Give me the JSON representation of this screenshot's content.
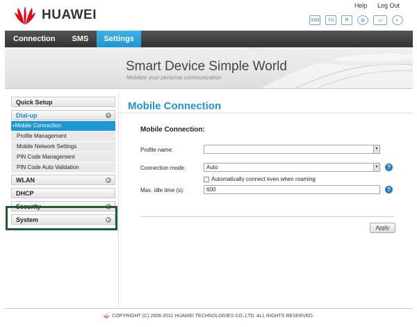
{
  "brand": {
    "name": "HUAWEI",
    "logo_color": "#e60012"
  },
  "top_links": {
    "help": "Help",
    "logout": "Log Out"
  },
  "status_icons": [
    {
      "name": "sim-icon",
      "glyph": "SIM"
    },
    {
      "name": "signal-icon",
      "glyph": "Yıl"
    },
    {
      "name": "network-r-icon",
      "glyph": "R"
    },
    {
      "name": "globe-icon",
      "glyph": "◍"
    },
    {
      "name": "monitor-icon",
      "glyph": "▭"
    },
    {
      "name": "wifi-icon",
      "glyph": "◐"
    }
  ],
  "nav": {
    "tabs": [
      "Connection",
      "SMS",
      "Settings"
    ],
    "active": "Settings",
    "accent": "#1d96d2"
  },
  "banner": {
    "title": "Smart Device   Simple World",
    "subtitle": "Mobilize your personal communication"
  },
  "sidebar": {
    "quick_setup": "Quick Setup",
    "dialup": "Dial-up",
    "dialup_items": [
      "+Mobile Connection",
      "Profile Management",
      "Mobile Network Settings",
      "PIN Code Management",
      "PIN Code Auto Validation"
    ],
    "wlan": "WLAN",
    "dhcp": "DHCP",
    "security": "Security",
    "system": "System"
  },
  "main": {
    "title": "Mobile Connection",
    "section": "Mobile Connection:",
    "profile_label": "Profile name:",
    "profile_value": "",
    "mode_label": "Connection mode:",
    "mode_value": "Auto",
    "roaming_label": "Automatically connect even when roaming",
    "idle_label": "Max. idle time (s):",
    "idle_value": "600",
    "apply": "Apply",
    "help_glyph": "?"
  },
  "footer": {
    "copyright": "COPYRIGHT (C) 2006-2011 HUAWEI TECHNOLOGIES CO.,LTD. ALL RIGHTS RESERVED."
  }
}
